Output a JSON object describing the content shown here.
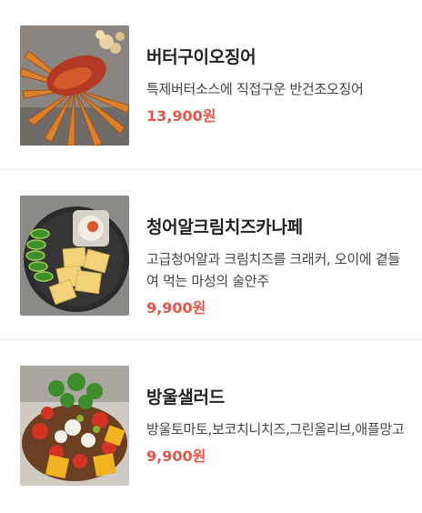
{
  "menu": {
    "items": [
      {
        "name": "버터구이오징어",
        "description": "특제버터소스에 직접구운 반건조오징어",
        "price": "13,900원"
      },
      {
        "name": "청어알크림치즈카나페",
        "description": "고급청어알과 크림치즈를 크래커, 오이에 곁들여 먹는 마성의 술안주",
        "price": "9,900원"
      },
      {
        "name": "방울샐러드",
        "description": "방울토마토,보코치니치즈,그린올리브,애플망고",
        "price": "9,900원"
      }
    ]
  }
}
